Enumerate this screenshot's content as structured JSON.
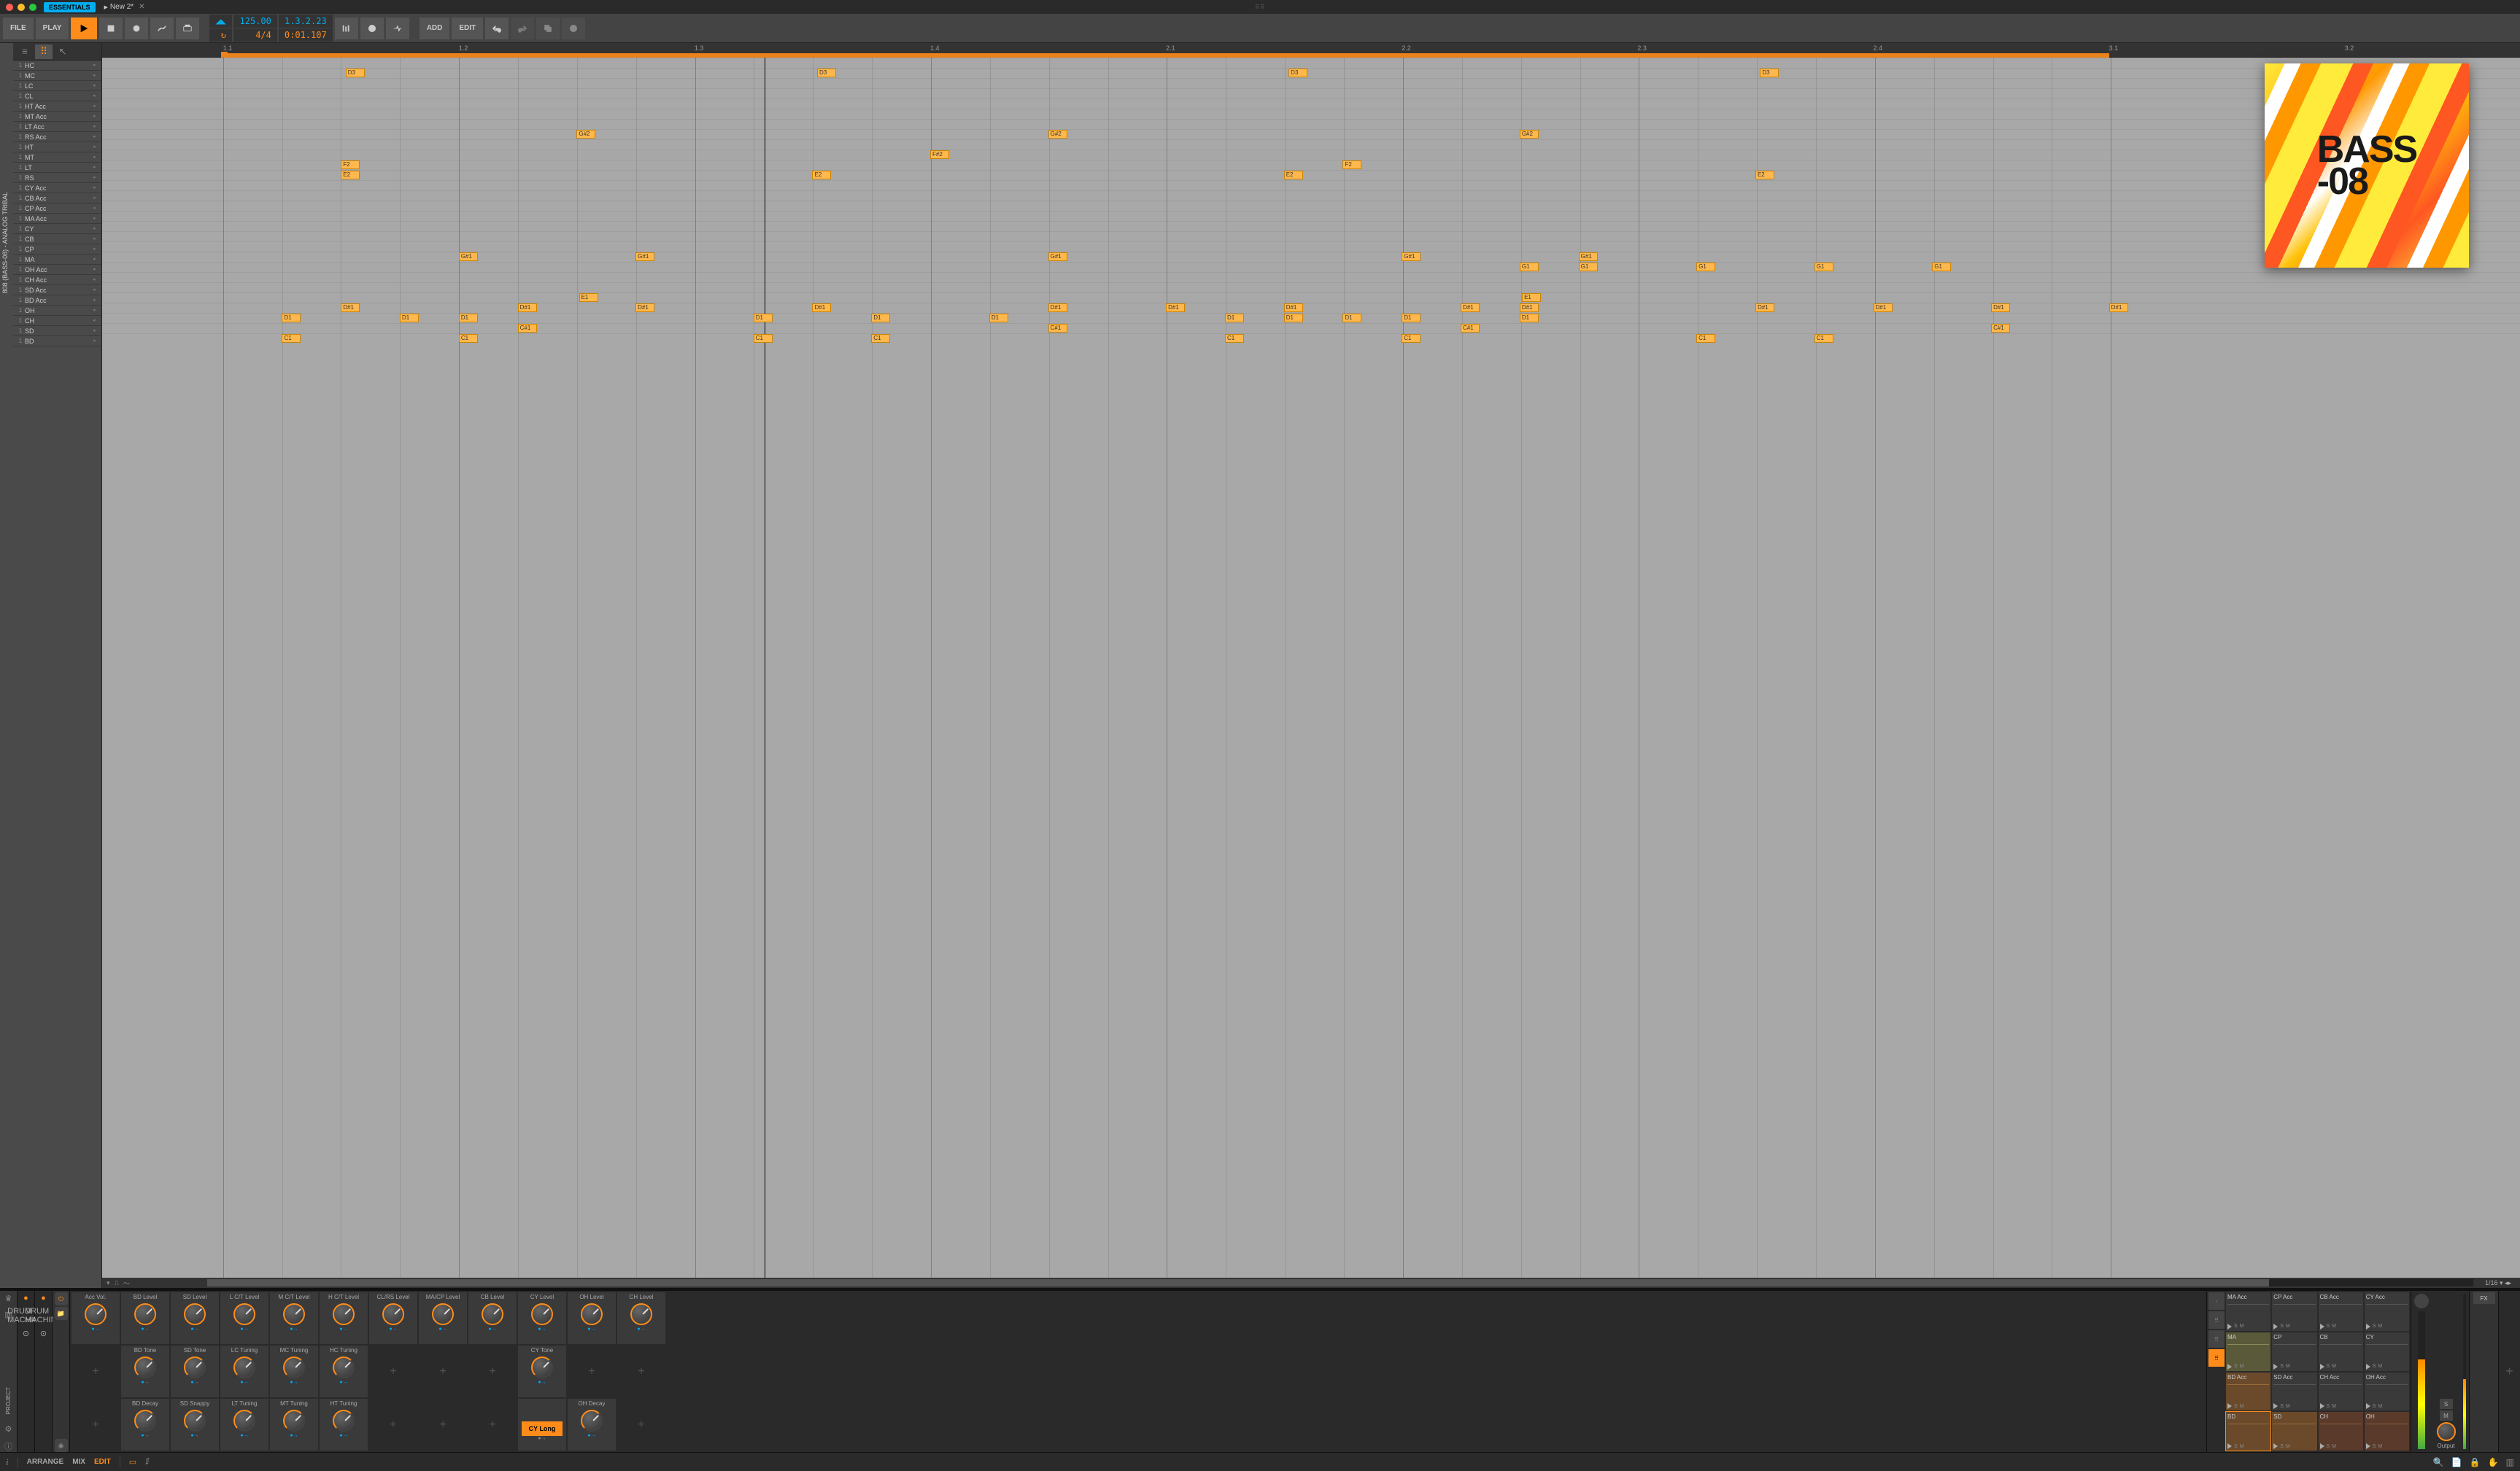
{
  "titlebar": {
    "badge": "ESSENTIALS",
    "tab_name": "New 2*"
  },
  "toolbar": {
    "file": "FILE",
    "play": "PLAY",
    "add": "ADD",
    "edit": "EDIT",
    "tempo": "125.00",
    "timesig": "4/4",
    "position": "1.3.2.23",
    "time": "0:01.107"
  },
  "clip_name": "808 (BASS-08) - ANALOG TRIBAL",
  "timeline": {
    "ticks": [
      "1.1",
      "1.2",
      "1.3",
      "1.4",
      "2.1",
      "2.2",
      "2.3",
      "2.4",
      "3.1",
      "3.2"
    ],
    "zoom": "1/16"
  },
  "tracks": [
    "HC",
    "MC",
    "LC",
    "CL",
    "HT Acc",
    "MT Acc",
    "LT Acc",
    "RS Acc",
    "HT",
    "MT",
    "LT",
    "RS",
    "CY Acc",
    "CB Acc",
    "CP Acc",
    "MA Acc",
    "CY",
    "CB",
    "CP",
    "MA",
    "OH Acc",
    "CH Acc",
    "SD Acc",
    "BD Acc",
    "OH",
    "CH",
    "SD",
    "BD"
  ],
  "notes": [
    {
      "row": 1,
      "pos": 0.52,
      "label": "D3"
    },
    {
      "row": 1,
      "pos": 2.52,
      "label": "D3"
    },
    {
      "row": 1,
      "pos": 4.52,
      "label": "D3"
    },
    {
      "row": 1,
      "pos": 6.52,
      "label": "D3"
    },
    {
      "row": 7,
      "pos": 1.5,
      "label": "G#2"
    },
    {
      "row": 7,
      "pos": 3.5,
      "label": "G#2"
    },
    {
      "row": 7,
      "pos": 5.5,
      "label": "G#2"
    },
    {
      "row": 9,
      "pos": 3.0,
      "label": "F#2"
    },
    {
      "row": 10,
      "pos": 0.5,
      "label": "F2"
    },
    {
      "row": 10,
      "pos": 4.75,
      "label": "F2"
    },
    {
      "row": 11,
      "pos": 0.5,
      "label": "E2"
    },
    {
      "row": 11,
      "pos": 2.5,
      "label": "E2"
    },
    {
      "row": 11,
      "pos": 4.5,
      "label": "E2"
    },
    {
      "row": 11,
      "pos": 6.5,
      "label": "E2"
    },
    {
      "row": 19,
      "pos": 1.0,
      "label": "G#1"
    },
    {
      "row": 19,
      "pos": 1.75,
      "label": "G#1"
    },
    {
      "row": 19,
      "pos": 3.5,
      "label": "G#1"
    },
    {
      "row": 19,
      "pos": 5.0,
      "label": "G#1"
    },
    {
      "row": 19,
      "pos": 5.75,
      "label": "G#1"
    },
    {
      "row": 20,
      "pos": 5.5,
      "label": "G1"
    },
    {
      "row": 20,
      "pos": 5.75,
      "label": "G1"
    },
    {
      "row": 20,
      "pos": 6.25,
      "label": "G1"
    },
    {
      "row": 20,
      "pos": 6.75,
      "label": "G1"
    },
    {
      "row": 20,
      "pos": 7.25,
      "label": "G1"
    },
    {
      "row": 23,
      "pos": 1.51,
      "label": "E1"
    },
    {
      "row": 23,
      "pos": 5.51,
      "label": "E1"
    },
    {
      "row": 24,
      "pos": 0.5,
      "label": "D#1"
    },
    {
      "row": 24,
      "pos": 1.25,
      "label": "D#1"
    },
    {
      "row": 24,
      "pos": 1.75,
      "label": "D#1"
    },
    {
      "row": 24,
      "pos": 2.5,
      "label": "D#1"
    },
    {
      "row": 24,
      "pos": 3.5,
      "label": "D#1"
    },
    {
      "row": 24,
      "pos": 4.0,
      "label": "D#1"
    },
    {
      "row": 24,
      "pos": 4.5,
      "label": "D#1"
    },
    {
      "row": 24,
      "pos": 5.25,
      "label": "D#1"
    },
    {
      "row": 24,
      "pos": 5.5,
      "label": "D#1"
    },
    {
      "row": 24,
      "pos": 6.5,
      "label": "D#1"
    },
    {
      "row": 24,
      "pos": 7.0,
      "label": "D#1"
    },
    {
      "row": 24,
      "pos": 7.5,
      "label": "D#1"
    },
    {
      "row": 24,
      "pos": 8.0,
      "label": "D#1"
    },
    {
      "row": 25,
      "pos": 0.25,
      "label": "D1"
    },
    {
      "row": 25,
      "pos": 0.75,
      "label": "D1"
    },
    {
      "row": 25,
      "pos": 1.0,
      "label": "D1"
    },
    {
      "row": 25,
      "pos": 2.25,
      "label": "D1"
    },
    {
      "row": 25,
      "pos": 2.75,
      "label": "D1"
    },
    {
      "row": 25,
      "pos": 3.25,
      "label": "D1"
    },
    {
      "row": 25,
      "pos": 4.25,
      "label": "D1"
    },
    {
      "row": 25,
      "pos": 4.5,
      "label": "D1"
    },
    {
      "row": 25,
      "pos": 4.75,
      "label": "D1"
    },
    {
      "row": 25,
      "pos": 5.0,
      "label": "D1"
    },
    {
      "row": 25,
      "pos": 5.5,
      "label": "D1"
    },
    {
      "row": 26,
      "pos": 1.25,
      "label": "C#1"
    },
    {
      "row": 26,
      "pos": 3.5,
      "label": "C#1"
    },
    {
      "row": 26,
      "pos": 5.25,
      "label": "C#1"
    },
    {
      "row": 26,
      "pos": 7.5,
      "label": "C#1"
    },
    {
      "row": 27,
      "pos": 0.25,
      "label": "C1"
    },
    {
      "row": 27,
      "pos": 1.0,
      "label": "C1"
    },
    {
      "row": 27,
      "pos": 2.25,
      "label": "C1"
    },
    {
      "row": 27,
      "pos": 2.75,
      "label": "C1"
    },
    {
      "row": 27,
      "pos": 4.25,
      "label": "C1"
    },
    {
      "row": 27,
      "pos": 5.0,
      "label": "C1"
    },
    {
      "row": 27,
      "pos": 6.25,
      "label": "C1"
    },
    {
      "row": 27,
      "pos": 6.75,
      "label": "C1"
    }
  ],
  "artwork": {
    "line1": "BASS",
    "line2": "-08"
  },
  "macros": {
    "row1": [
      "Acc Vol.",
      "BD Level",
      "SD Level",
      "L C/T Level",
      "M C/T Level",
      "H C/T Level",
      "CL/RS Level",
      "MA/CP Level",
      "CB Level",
      "CY Level",
      "OH Level",
      "CH Level"
    ],
    "row2": [
      "",
      "BD Tone",
      "SD Tone",
      "LC Tuning",
      "MC Tuning",
      "HC Tuning",
      "",
      "",
      "",
      "CY Tone",
      "",
      ""
    ],
    "row3": [
      "",
      "BD Decay",
      "SD Snappy",
      "LT Tuning",
      "MT Tuning",
      "HT Tuning",
      "",
      "",
      "",
      "CY Long",
      "OH Decay",
      ""
    ]
  },
  "pads": [
    [
      "MA Acc",
      "CP Acc",
      "CB Acc",
      "CY Acc"
    ],
    [
      "MA",
      "CP",
      "CB",
      "CY"
    ],
    [
      "BD Acc",
      "SD Acc",
      "CH Acc",
      "OH Acc"
    ],
    [
      "BD",
      "SD",
      "CH",
      "OH"
    ]
  ],
  "output": {
    "s": "S",
    "m": "M",
    "label": "Output",
    "fx": "FX"
  },
  "statusbar": {
    "arrange": "ARRANGE",
    "mix": "MIX",
    "edit": "EDIT"
  },
  "project_label": "PROJECT",
  "drum_machine": "DRUM MACHINE"
}
